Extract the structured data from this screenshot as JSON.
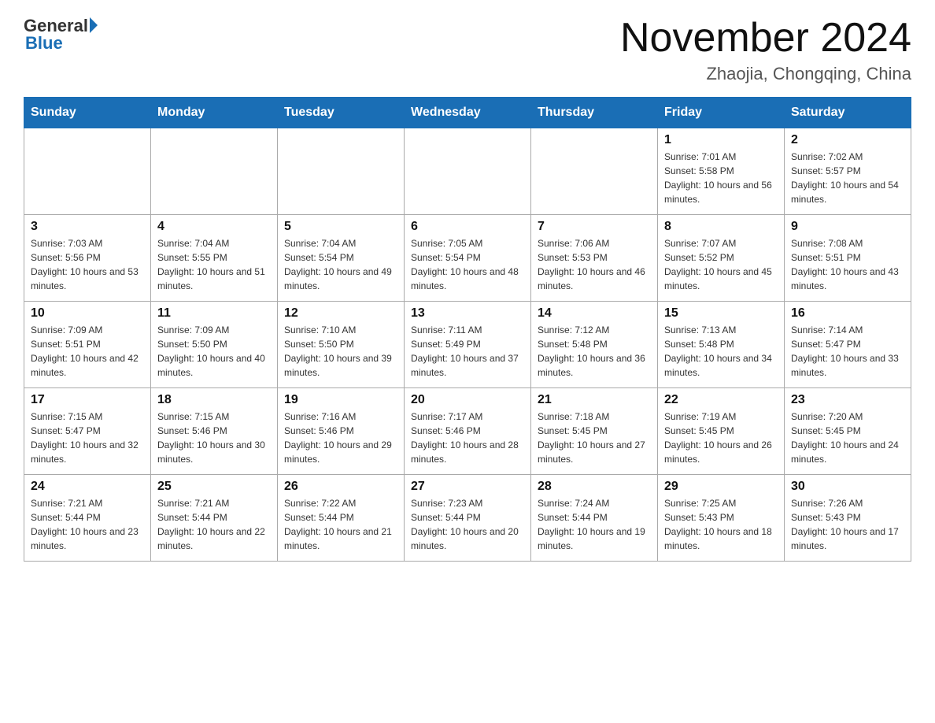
{
  "header": {
    "logo_general": "General",
    "logo_blue": "Blue",
    "month_title": "November 2024",
    "location": "Zhaojia, Chongqing, China"
  },
  "weekdays": [
    "Sunday",
    "Monday",
    "Tuesday",
    "Wednesday",
    "Thursday",
    "Friday",
    "Saturday"
  ],
  "weeks": [
    [
      {
        "day": "",
        "info": ""
      },
      {
        "day": "",
        "info": ""
      },
      {
        "day": "",
        "info": ""
      },
      {
        "day": "",
        "info": ""
      },
      {
        "day": "",
        "info": ""
      },
      {
        "day": "1",
        "info": "Sunrise: 7:01 AM\nSunset: 5:58 PM\nDaylight: 10 hours and 56 minutes."
      },
      {
        "day": "2",
        "info": "Sunrise: 7:02 AM\nSunset: 5:57 PM\nDaylight: 10 hours and 54 minutes."
      }
    ],
    [
      {
        "day": "3",
        "info": "Sunrise: 7:03 AM\nSunset: 5:56 PM\nDaylight: 10 hours and 53 minutes."
      },
      {
        "day": "4",
        "info": "Sunrise: 7:04 AM\nSunset: 5:55 PM\nDaylight: 10 hours and 51 minutes."
      },
      {
        "day": "5",
        "info": "Sunrise: 7:04 AM\nSunset: 5:54 PM\nDaylight: 10 hours and 49 minutes."
      },
      {
        "day": "6",
        "info": "Sunrise: 7:05 AM\nSunset: 5:54 PM\nDaylight: 10 hours and 48 minutes."
      },
      {
        "day": "7",
        "info": "Sunrise: 7:06 AM\nSunset: 5:53 PM\nDaylight: 10 hours and 46 minutes."
      },
      {
        "day": "8",
        "info": "Sunrise: 7:07 AM\nSunset: 5:52 PM\nDaylight: 10 hours and 45 minutes."
      },
      {
        "day": "9",
        "info": "Sunrise: 7:08 AM\nSunset: 5:51 PM\nDaylight: 10 hours and 43 minutes."
      }
    ],
    [
      {
        "day": "10",
        "info": "Sunrise: 7:09 AM\nSunset: 5:51 PM\nDaylight: 10 hours and 42 minutes."
      },
      {
        "day": "11",
        "info": "Sunrise: 7:09 AM\nSunset: 5:50 PM\nDaylight: 10 hours and 40 minutes."
      },
      {
        "day": "12",
        "info": "Sunrise: 7:10 AM\nSunset: 5:50 PM\nDaylight: 10 hours and 39 minutes."
      },
      {
        "day": "13",
        "info": "Sunrise: 7:11 AM\nSunset: 5:49 PM\nDaylight: 10 hours and 37 minutes."
      },
      {
        "day": "14",
        "info": "Sunrise: 7:12 AM\nSunset: 5:48 PM\nDaylight: 10 hours and 36 minutes."
      },
      {
        "day": "15",
        "info": "Sunrise: 7:13 AM\nSunset: 5:48 PM\nDaylight: 10 hours and 34 minutes."
      },
      {
        "day": "16",
        "info": "Sunrise: 7:14 AM\nSunset: 5:47 PM\nDaylight: 10 hours and 33 minutes."
      }
    ],
    [
      {
        "day": "17",
        "info": "Sunrise: 7:15 AM\nSunset: 5:47 PM\nDaylight: 10 hours and 32 minutes."
      },
      {
        "day": "18",
        "info": "Sunrise: 7:15 AM\nSunset: 5:46 PM\nDaylight: 10 hours and 30 minutes."
      },
      {
        "day": "19",
        "info": "Sunrise: 7:16 AM\nSunset: 5:46 PM\nDaylight: 10 hours and 29 minutes."
      },
      {
        "day": "20",
        "info": "Sunrise: 7:17 AM\nSunset: 5:46 PM\nDaylight: 10 hours and 28 minutes."
      },
      {
        "day": "21",
        "info": "Sunrise: 7:18 AM\nSunset: 5:45 PM\nDaylight: 10 hours and 27 minutes."
      },
      {
        "day": "22",
        "info": "Sunrise: 7:19 AM\nSunset: 5:45 PM\nDaylight: 10 hours and 26 minutes."
      },
      {
        "day": "23",
        "info": "Sunrise: 7:20 AM\nSunset: 5:45 PM\nDaylight: 10 hours and 24 minutes."
      }
    ],
    [
      {
        "day": "24",
        "info": "Sunrise: 7:21 AM\nSunset: 5:44 PM\nDaylight: 10 hours and 23 minutes."
      },
      {
        "day": "25",
        "info": "Sunrise: 7:21 AM\nSunset: 5:44 PM\nDaylight: 10 hours and 22 minutes."
      },
      {
        "day": "26",
        "info": "Sunrise: 7:22 AM\nSunset: 5:44 PM\nDaylight: 10 hours and 21 minutes."
      },
      {
        "day": "27",
        "info": "Sunrise: 7:23 AM\nSunset: 5:44 PM\nDaylight: 10 hours and 20 minutes."
      },
      {
        "day": "28",
        "info": "Sunrise: 7:24 AM\nSunset: 5:44 PM\nDaylight: 10 hours and 19 minutes."
      },
      {
        "day": "29",
        "info": "Sunrise: 7:25 AM\nSunset: 5:43 PM\nDaylight: 10 hours and 18 minutes."
      },
      {
        "day": "30",
        "info": "Sunrise: 7:26 AM\nSunset: 5:43 PM\nDaylight: 10 hours and 17 minutes."
      }
    ]
  ]
}
